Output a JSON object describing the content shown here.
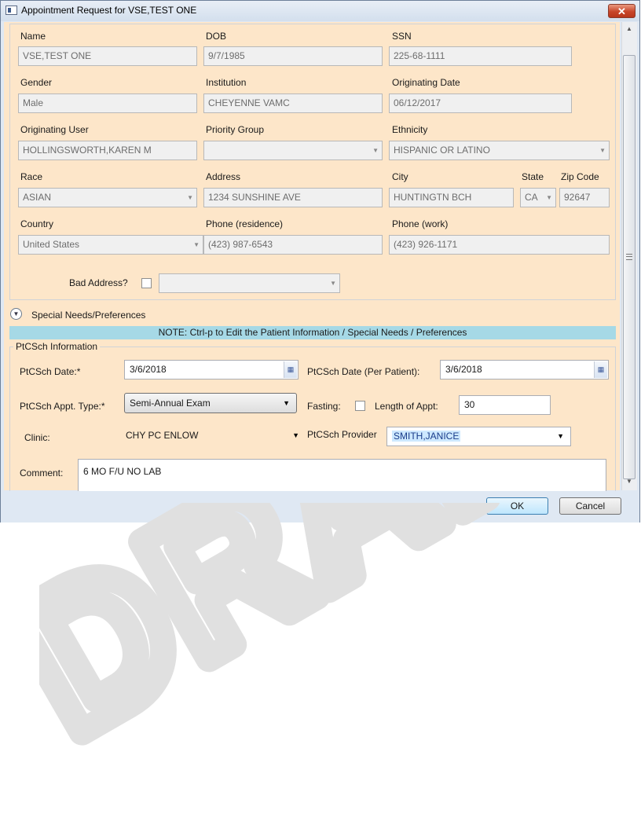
{
  "window": {
    "title": "Appointment Request for VSE,TEST ONE",
    "close_glyph": "✕"
  },
  "patient": {
    "name_label": "Name",
    "name_value": "VSE,TEST ONE",
    "dob_label": "DOB",
    "dob_value": "9/7/1985",
    "ssn_label": "SSN",
    "ssn_value": "225-68-1111",
    "gender_label": "Gender",
    "gender_value": "Male",
    "institution_label": "Institution",
    "institution_value": "CHEYENNE VAMC",
    "orig_date_label": "Originating Date",
    "orig_date_value": "06/12/2017",
    "orig_user_label": "Originating User",
    "orig_user_value": "HOLLINGSWORTH,KAREN M",
    "priority_label": "Priority Group",
    "priority_value": "",
    "ethnicity_label": "Ethnicity",
    "ethnicity_value": "HISPANIC OR LATINO",
    "race_label": "Race",
    "race_value": "ASIAN",
    "address_label": "Address",
    "address_value": "1234 SUNSHINE AVE",
    "city_label": "City",
    "city_value": "HUNTINGTN BCH",
    "state_label": "State",
    "state_value": "CA",
    "zip_label": "Zip Code",
    "zip_value": "92647",
    "country_label": "Country",
    "country_value": "United States",
    "phone_res_label": "Phone (residence)",
    "phone_res_value": "(423) 987-6543",
    "phone_work_label": "Phone (work)",
    "phone_work_value": "(423) 926-1171",
    "bad_address_label": "Bad Address?",
    "bad_address_reason": ""
  },
  "special_needs": {
    "label": "Special Needs/Preferences"
  },
  "note": "NOTE:  Ctrl-p to Edit the Patient Information / Special Needs / Preferences",
  "ptcsch": {
    "legend": "PtCSch Information",
    "date_label": "PtCSch Date:*",
    "date_value": "3/6/2018",
    "date_pp_label": "PtCSch Date (Per Patient):",
    "date_pp_value": "3/6/2018",
    "appt_type_label": "PtCSch Appt. Type:*",
    "appt_type_value": "Semi-Annual Exam",
    "fasting_label": "Fasting:",
    "length_label": "Length of Appt:",
    "length_value": "30",
    "clinic_label": "Clinic:",
    "clinic_value": "CHY PC ENLOW",
    "provider_label": "PtCSch Provider",
    "provider_value": "SMITH,JANICE",
    "comment_label": "Comment:",
    "comment_value": "6 MO F/U NO LAB"
  },
  "buttons": {
    "ok": "OK",
    "cancel": "Cancel"
  },
  "watermark": "DRAFT",
  "colors": {
    "panel_bg": "#fde6c9",
    "note_bg": "#a6d9e6",
    "window_frame": "#dfe8f3"
  }
}
